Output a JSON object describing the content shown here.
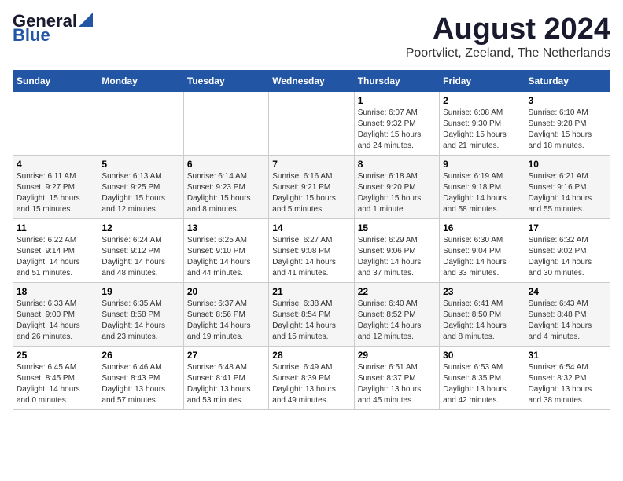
{
  "logo": {
    "general": "General",
    "blue": "Blue"
  },
  "title": "August 2024",
  "subtitle": "Poortvliet, Zeeland, The Netherlands",
  "days_of_week": [
    "Sunday",
    "Monday",
    "Tuesday",
    "Wednesday",
    "Thursday",
    "Friday",
    "Saturday"
  ],
  "weeks": [
    [
      {
        "day": "",
        "info": ""
      },
      {
        "day": "",
        "info": ""
      },
      {
        "day": "",
        "info": ""
      },
      {
        "day": "",
        "info": ""
      },
      {
        "day": "1",
        "info": "Sunrise: 6:07 AM\nSunset: 9:32 PM\nDaylight: 15 hours\nand 24 minutes."
      },
      {
        "day": "2",
        "info": "Sunrise: 6:08 AM\nSunset: 9:30 PM\nDaylight: 15 hours\nand 21 minutes."
      },
      {
        "day": "3",
        "info": "Sunrise: 6:10 AM\nSunset: 9:28 PM\nDaylight: 15 hours\nand 18 minutes."
      }
    ],
    [
      {
        "day": "4",
        "info": "Sunrise: 6:11 AM\nSunset: 9:27 PM\nDaylight: 15 hours\nand 15 minutes."
      },
      {
        "day": "5",
        "info": "Sunrise: 6:13 AM\nSunset: 9:25 PM\nDaylight: 15 hours\nand 12 minutes."
      },
      {
        "day": "6",
        "info": "Sunrise: 6:14 AM\nSunset: 9:23 PM\nDaylight: 15 hours\nand 8 minutes."
      },
      {
        "day": "7",
        "info": "Sunrise: 6:16 AM\nSunset: 9:21 PM\nDaylight: 15 hours\nand 5 minutes."
      },
      {
        "day": "8",
        "info": "Sunrise: 6:18 AM\nSunset: 9:20 PM\nDaylight: 15 hours\nand 1 minute."
      },
      {
        "day": "9",
        "info": "Sunrise: 6:19 AM\nSunset: 9:18 PM\nDaylight: 14 hours\nand 58 minutes."
      },
      {
        "day": "10",
        "info": "Sunrise: 6:21 AM\nSunset: 9:16 PM\nDaylight: 14 hours\nand 55 minutes."
      }
    ],
    [
      {
        "day": "11",
        "info": "Sunrise: 6:22 AM\nSunset: 9:14 PM\nDaylight: 14 hours\nand 51 minutes."
      },
      {
        "day": "12",
        "info": "Sunrise: 6:24 AM\nSunset: 9:12 PM\nDaylight: 14 hours\nand 48 minutes."
      },
      {
        "day": "13",
        "info": "Sunrise: 6:25 AM\nSunset: 9:10 PM\nDaylight: 14 hours\nand 44 minutes."
      },
      {
        "day": "14",
        "info": "Sunrise: 6:27 AM\nSunset: 9:08 PM\nDaylight: 14 hours\nand 41 minutes."
      },
      {
        "day": "15",
        "info": "Sunrise: 6:29 AM\nSunset: 9:06 PM\nDaylight: 14 hours\nand 37 minutes."
      },
      {
        "day": "16",
        "info": "Sunrise: 6:30 AM\nSunset: 9:04 PM\nDaylight: 14 hours\nand 33 minutes."
      },
      {
        "day": "17",
        "info": "Sunrise: 6:32 AM\nSunset: 9:02 PM\nDaylight: 14 hours\nand 30 minutes."
      }
    ],
    [
      {
        "day": "18",
        "info": "Sunrise: 6:33 AM\nSunset: 9:00 PM\nDaylight: 14 hours\nand 26 minutes."
      },
      {
        "day": "19",
        "info": "Sunrise: 6:35 AM\nSunset: 8:58 PM\nDaylight: 14 hours\nand 23 minutes."
      },
      {
        "day": "20",
        "info": "Sunrise: 6:37 AM\nSunset: 8:56 PM\nDaylight: 14 hours\nand 19 minutes."
      },
      {
        "day": "21",
        "info": "Sunrise: 6:38 AM\nSunset: 8:54 PM\nDaylight: 14 hours\nand 15 minutes."
      },
      {
        "day": "22",
        "info": "Sunrise: 6:40 AM\nSunset: 8:52 PM\nDaylight: 14 hours\nand 12 minutes."
      },
      {
        "day": "23",
        "info": "Sunrise: 6:41 AM\nSunset: 8:50 PM\nDaylight: 14 hours\nand 8 minutes."
      },
      {
        "day": "24",
        "info": "Sunrise: 6:43 AM\nSunset: 8:48 PM\nDaylight: 14 hours\nand 4 minutes."
      }
    ],
    [
      {
        "day": "25",
        "info": "Sunrise: 6:45 AM\nSunset: 8:45 PM\nDaylight: 14 hours\nand 0 minutes."
      },
      {
        "day": "26",
        "info": "Sunrise: 6:46 AM\nSunset: 8:43 PM\nDaylight: 13 hours\nand 57 minutes."
      },
      {
        "day": "27",
        "info": "Sunrise: 6:48 AM\nSunset: 8:41 PM\nDaylight: 13 hours\nand 53 minutes."
      },
      {
        "day": "28",
        "info": "Sunrise: 6:49 AM\nSunset: 8:39 PM\nDaylight: 13 hours\nand 49 minutes."
      },
      {
        "day": "29",
        "info": "Sunrise: 6:51 AM\nSunset: 8:37 PM\nDaylight: 13 hours\nand 45 minutes."
      },
      {
        "day": "30",
        "info": "Sunrise: 6:53 AM\nSunset: 8:35 PM\nDaylight: 13 hours\nand 42 minutes."
      },
      {
        "day": "31",
        "info": "Sunrise: 6:54 AM\nSunset: 8:32 PM\nDaylight: 13 hours\nand 38 minutes."
      }
    ]
  ]
}
